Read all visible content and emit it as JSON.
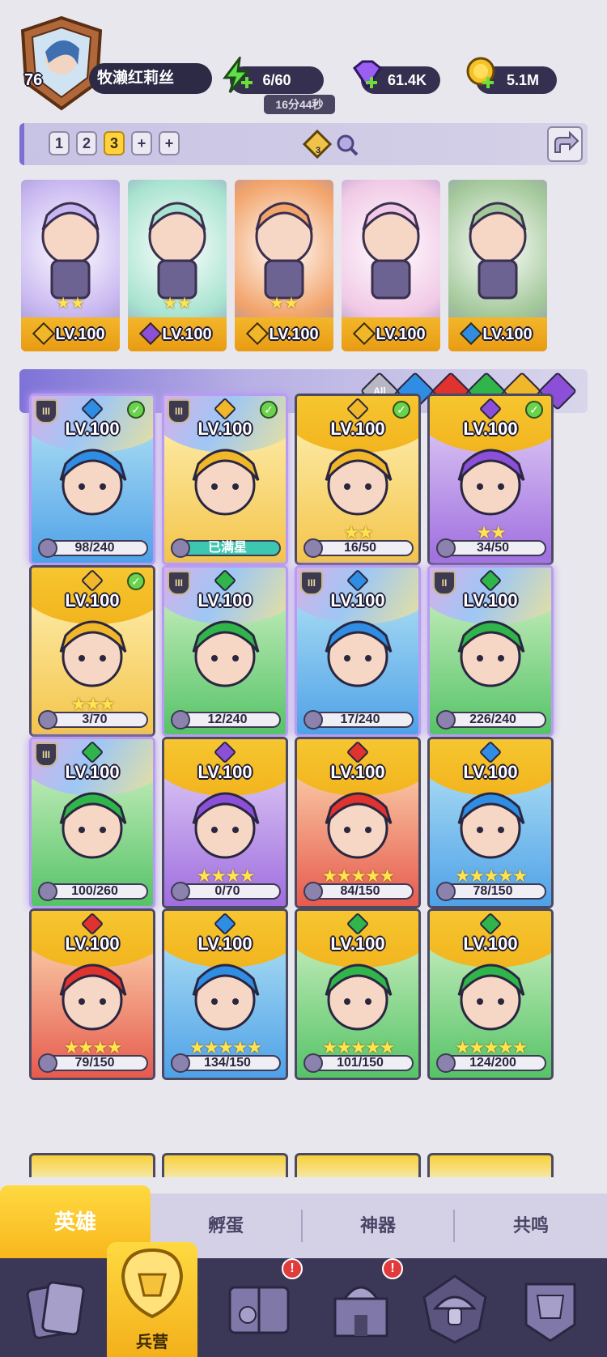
{
  "player": {
    "level": "76",
    "name": "牧濑红莉丝"
  },
  "resources": {
    "energy": "6/60",
    "energy_timer": "16分44秒",
    "gems": "61.4K",
    "gold": "5.1M"
  },
  "team_slots": [
    "1",
    "2",
    "3",
    "+",
    "+"
  ],
  "team_badge": "3",
  "team": [
    {
      "level": "LV.100",
      "element": "light",
      "stars": "★★"
    },
    {
      "level": "LV.100",
      "element": "dark",
      "stars": "★★"
    },
    {
      "level": "LV.100",
      "element": "light",
      "stars": "★★"
    },
    {
      "level": "LV.100",
      "element": "light",
      "stars": ""
    },
    {
      "level": "LV.100",
      "element": "water",
      "stars": ""
    }
  ],
  "filters": [
    "All",
    "water",
    "fire",
    "wind",
    "light",
    "dark"
  ],
  "filter_all_label": "All",
  "heroes": [
    {
      "level": "LV.100",
      "progress": "98/240",
      "stars": "",
      "element": "water",
      "rank": "III",
      "check": true
    },
    {
      "level": "LV.100",
      "progress": "已满星",
      "stars": "",
      "element": "light",
      "rank": "III",
      "check": true,
      "full": true
    },
    {
      "level": "LV.100",
      "progress": "16/50",
      "stars": "★★",
      "element": "light",
      "rank": "",
      "check": true
    },
    {
      "level": "LV.100",
      "progress": "34/50",
      "stars": "★★",
      "element": "dark",
      "rank": "",
      "check": true
    },
    {
      "level": "LV.100",
      "progress": "3/70",
      "stars": "★★★",
      "element": "light",
      "rank": "",
      "check": true
    },
    {
      "level": "LV.100",
      "progress": "12/240",
      "stars": "",
      "element": "wind",
      "rank": "III",
      "check": false
    },
    {
      "level": "LV.100",
      "progress": "17/240",
      "stars": "",
      "element": "water",
      "rank": "III",
      "check": false
    },
    {
      "level": "LV.100",
      "progress": "226/240",
      "stars": "",
      "element": "wind",
      "rank": "II",
      "check": false
    },
    {
      "level": "LV.100",
      "progress": "100/260",
      "stars": "",
      "element": "wind",
      "rank": "III",
      "check": false
    },
    {
      "level": "LV.100",
      "progress": "0/70",
      "stars": "★★★★",
      "element": "dark",
      "rank": "",
      "check": false
    },
    {
      "level": "LV.100",
      "progress": "84/150",
      "stars": "★★★★★",
      "element": "fire",
      "rank": "",
      "check": false
    },
    {
      "level": "LV.100",
      "progress": "78/150",
      "stars": "★★★★★",
      "element": "water",
      "rank": "",
      "check": false
    },
    {
      "level": "LV.100",
      "progress": "79/150",
      "stars": "★★★★",
      "element": "fire",
      "rank": "",
      "check": false
    },
    {
      "level": "LV.100",
      "progress": "134/150",
      "stars": "★★★★★",
      "element": "water",
      "rank": "",
      "check": false
    },
    {
      "level": "LV.100",
      "progress": "101/150",
      "stars": "★★★★★",
      "element": "wind",
      "rank": "",
      "check": false
    },
    {
      "level": "LV.100",
      "progress": "124/200",
      "stars": "★★★★★",
      "element": "wind",
      "rank": "",
      "check": false
    }
  ],
  "tabs": [
    "英雄",
    "孵蛋",
    "神器",
    "共鸣"
  ],
  "nav": {
    "barracks_label": "兵营",
    "alert_mark": "!"
  },
  "colors": {
    "water": "#2f8de4",
    "fire": "#e0322e",
    "wind": "#2fb54a",
    "light": "#f0b72a",
    "dark": "#8b4fd8",
    "accent": "#ffd23e",
    "panel": "#3b3757"
  }
}
